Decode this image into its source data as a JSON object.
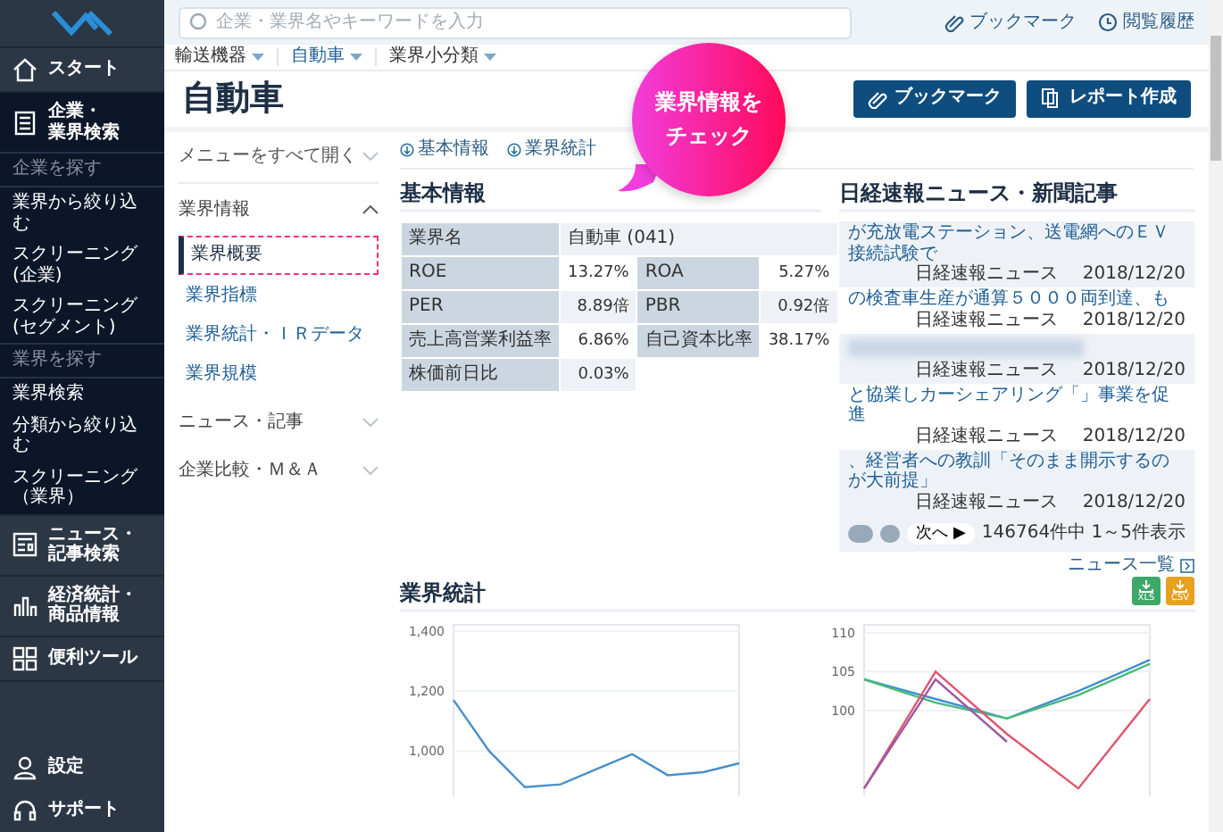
{
  "sidebar": {
    "items": [
      {
        "kind": "nav",
        "label": [
          "スタート"
        ],
        "selected": false
      },
      {
        "kind": "nav",
        "label": [
          "企業・",
          "業界検索"
        ],
        "selected": true
      },
      {
        "kind": "heading",
        "label": "企業を探す"
      },
      {
        "kind": "link",
        "label": "業界から絞り込む"
      },
      {
        "kind": "link",
        "label": "スクリーニング(企業)"
      },
      {
        "kind": "link",
        "label": "スクリーニング(セグメント)"
      },
      {
        "kind": "heading",
        "label": "業界を探す"
      },
      {
        "kind": "link",
        "label": "業界検索"
      },
      {
        "kind": "link",
        "label": "分類から絞り込む"
      },
      {
        "kind": "link",
        "label": "スクリーニング（業界）"
      },
      {
        "kind": "nav",
        "label": [
          "ニュース・",
          "記事検索"
        ],
        "selected": false
      },
      {
        "kind": "nav",
        "label": [
          "経済統計・",
          "商品情報"
        ],
        "selected": false
      },
      {
        "kind": "nav",
        "label": [
          "便利ツール"
        ],
        "selected": false
      }
    ],
    "bottom": [
      "設定",
      "サポート"
    ]
  },
  "search": {
    "placeholder": "企業・業界名やキーワードを入力"
  },
  "header_links": [
    "ブックマーク",
    "閲覧履歴"
  ],
  "breadcrumb": [
    "輸送機器",
    "自動車",
    "業界小分類"
  ],
  "title": "自動車",
  "title_buttons": [
    "ブックマーク",
    "レポート作成"
  ],
  "callout": [
    "業界情報を",
    "チェック"
  ],
  "menu": {
    "open_all": "メニューをすべて開く",
    "sections": [
      {
        "label": "業界情報",
        "expanded": true,
        "children": [
          {
            "label": "業界概要",
            "selected": true
          },
          {
            "label": "業界指標",
            "selected": false
          },
          {
            "label": "業界統計・ＩＲデータ",
            "selected": false
          },
          {
            "label": "業界規模",
            "selected": false
          }
        ]
      },
      {
        "label": "ニュース・記事",
        "expanded": false
      },
      {
        "label": "企業比較・Ｍ＆Ａ",
        "expanded": false
      }
    ]
  },
  "anchors": [
    "基本情報",
    "業界統計"
  ],
  "basic_info": {
    "heading": "基本情報",
    "rows": [
      [
        {
          "label": "業界名",
          "value": "自動車 (041)",
          "wide": true
        }
      ],
      [
        {
          "label": "ROE",
          "value": "13.27%",
          "wide": false
        },
        {
          "label": "ROA",
          "value": "5.27%",
          "wide": false
        }
      ],
      [
        {
          "label": "PER",
          "value": "8.89倍",
          "wide": false
        },
        {
          "label": "PBR",
          "value": "0.92倍",
          "wide": false
        }
      ],
      [
        {
          "label": "売上高営業利益率",
          "value": "6.86%",
          "wide": false
        },
        {
          "label": "自己資本比率",
          "value": "38.17%",
          "wide": false
        }
      ],
      [
        {
          "label": "株価前日比",
          "value": "0.03%",
          "wide": false
        }
      ]
    ]
  },
  "news": {
    "heading": "日経速報ニュース・新聞記事",
    "items": [
      {
        "title": "が充放電ステーション、送電網へのＥＶ接続試験で",
        "source": "日経速報ニュース",
        "date": "2018/12/20"
      },
      {
        "title": "の検査車生産が通算５０００両到達、も",
        "source": "日経速報ニュース",
        "date": "2018/12/20"
      },
      {
        "source": "日経速報ニュース",
        "date": "2018/12/20"
      },
      {
        "title": "と協業しカーシェアリング「」事業を促進",
        "source": "日経速報ニュース",
        "date": "2018/12/20"
      },
      {
        "title": "、経営者への教訓「そのまま開示するのが大前提」",
        "source": "日経速報ニュース",
        "date": "2018/12/20"
      }
    ],
    "next": "次へ ▶",
    "count": "146764件中 1～5件表示",
    "more": "ニュース一覧"
  },
  "stats": {
    "heading": "業界統計",
    "downloads": [
      "XLS",
      "CSV"
    ],
    "charts": [
      {
        "chart_data": {
          "type": "line",
          "grid": true,
          "ylim": [
            850,
            1420
          ],
          "yticks": [
            {
              "value": 1000,
              "label": "1,000"
            },
            {
              "value": 1200,
              "label": "1,200"
            },
            {
              "value": 1400,
              "label": "1,400"
            }
          ],
          "series": [
            {
              "color": "#4a90c8",
              "values": [
                1170,
                1000,
                880,
                890,
                940,
                990,
                920,
                930,
                960
              ]
            }
          ]
        }
      },
      {
        "chart_data": {
          "type": "line",
          "grid": true,
          "ylim": [
            89,
            111
          ],
          "yticks": [
            100,
            105,
            110
          ],
          "series": [
            {
              "color": "#3f8fd0",
              "values": [
                104,
                101.5,
                99,
                102.5,
                106.5
              ]
            },
            {
              "color": "#4cb87a",
              "values": [
                104,
                101,
                99,
                102,
                106
              ]
            },
            {
              "color": "#e0556e",
              "values": [
                90,
                105,
                97,
                90,
                101.5
              ]
            },
            {
              "color": "#9a5aa0",
              "values": [
                90,
                104,
                96,
                null,
                null
              ]
            }
          ]
        }
      }
    ]
  }
}
